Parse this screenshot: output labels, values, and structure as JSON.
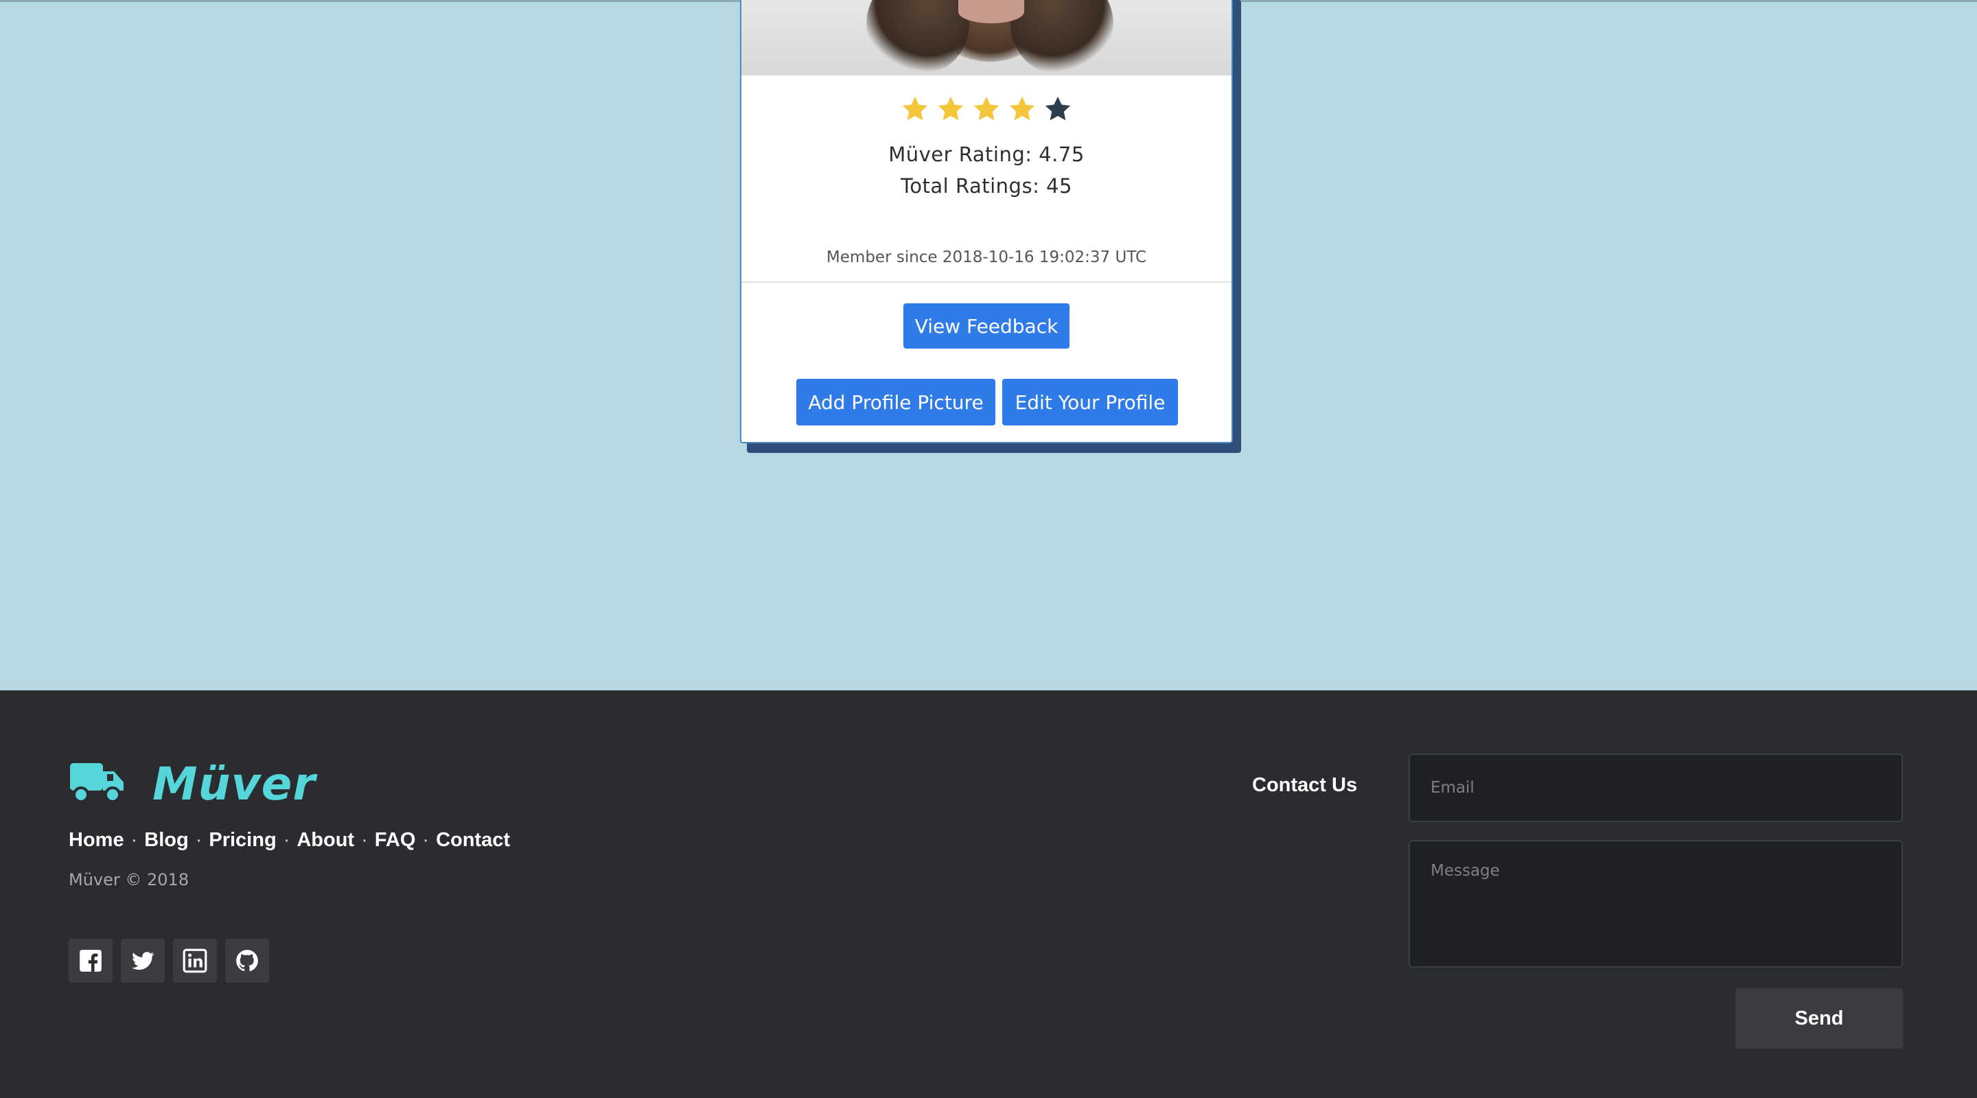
{
  "profile": {
    "stars": [
      {
        "icon": "star-filled-icon",
        "color": "#f4c73a"
      },
      {
        "icon": "star-filled-icon",
        "color": "#f4c73a"
      },
      {
        "icon": "star-filled-icon",
        "color": "#f4c73a"
      },
      {
        "icon": "star-filled-icon",
        "color": "#f4c73a"
      },
      {
        "icon": "star-empty-icon",
        "color": "#2d3e50"
      }
    ],
    "rating_line": "Müver Rating: 4.75",
    "total_line": "Total Ratings: 45",
    "member_since": "Member since 2018-10-16 19:02:37 UTC",
    "view_feedback_label": "View Feedback",
    "add_picture_label": "Add Profile Picture",
    "edit_profile_label": "Edit Your Profile"
  },
  "footer": {
    "brand": "Müver",
    "logo_icon": "truck-icon",
    "brand_color": "#56d6da",
    "nav": [
      "Home",
      "Blog",
      "Pricing",
      "About",
      "FAQ",
      "Contact"
    ],
    "copyright": "Müver © 2018",
    "socials": [
      {
        "name": "facebook-icon"
      },
      {
        "name": "twitter-icon"
      },
      {
        "name": "linkedin-icon"
      },
      {
        "name": "github-icon"
      }
    ],
    "contact_label": "Contact Us",
    "email_placeholder": "Email",
    "message_placeholder": "Message",
    "send_label": "Send"
  },
  "colors": {
    "page_background": "#b6d8e3",
    "footer_background": "#2a2c30",
    "button_blue": "#2f7be8"
  }
}
